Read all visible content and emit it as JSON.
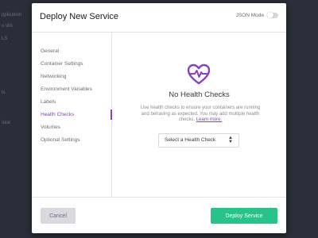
{
  "background": {
    "sidebar_fragments": [
      "pplication",
      "u Wo",
      "LS",
      "ts",
      "uice"
    ]
  },
  "modal": {
    "title": "Deploy New Service",
    "json_mode": {
      "label": "JSON Mode",
      "enabled": false
    }
  },
  "nav": {
    "items": [
      {
        "label": "General",
        "active": false
      },
      {
        "label": "Container Settings",
        "active": false
      },
      {
        "label": "Networking",
        "active": false
      },
      {
        "label": "Environment Variables",
        "active": false
      },
      {
        "label": "Labels",
        "active": false
      },
      {
        "label": "Health Checks",
        "active": true
      },
      {
        "label": "Volumes",
        "active": false
      },
      {
        "label": "Optional Settings",
        "active": false
      }
    ]
  },
  "content": {
    "icon": "heart-pulse-icon",
    "title": "No Health Checks",
    "description": "Use health checks to ensure your containers are running and behaving as expected. You may add multiple health checks.",
    "learn_more": "Learn more.",
    "select": {
      "value": "Select a Health Check"
    }
  },
  "footer": {
    "cancel_label": "Cancel",
    "deploy_label": "Deploy Service"
  },
  "colors": {
    "accent": "#8a3fc7",
    "primary_button": "#27c38a",
    "secondary_button": "#dadade",
    "backdrop": "#2a2d36"
  }
}
